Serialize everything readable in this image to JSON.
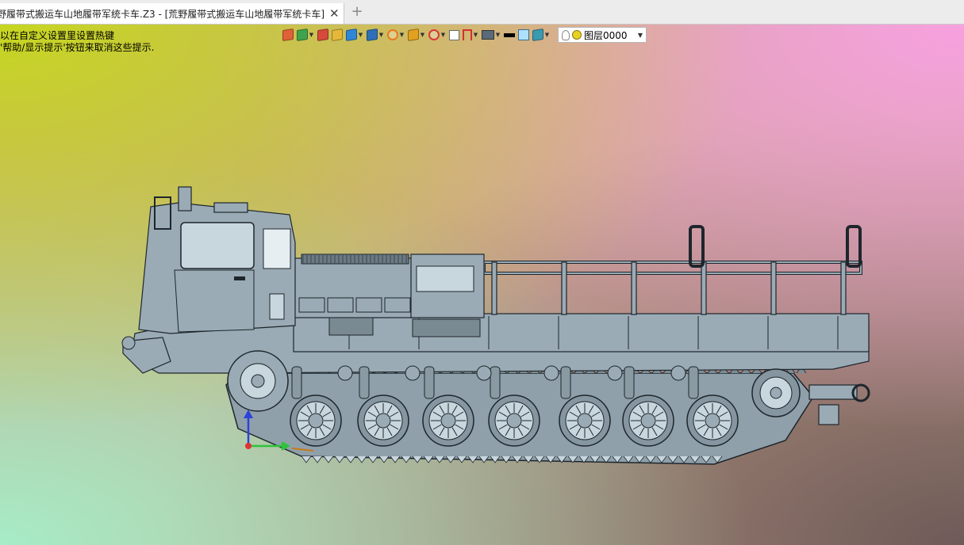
{
  "tab": {
    "title": "野履带式搬运车山地履带军统卡车.Z3 - [荒野履带式搬运车山地履带军统卡车]",
    "close": "✕",
    "add": "+"
  },
  "hints": [
    "以在自定义设置里设置热键",
    "'帮助/显示提示'按钮来取消这些提示."
  ],
  "toolbar": {
    "buttons": [
      {
        "name": "import-icon",
        "color": "#e0603a"
      },
      {
        "name": "paint-bucket-icon",
        "color": "#3fa34d",
        "dropdown": true
      },
      {
        "name": "pencil-icon",
        "color": "#d64a3a"
      },
      {
        "name": "box-yellow-icon",
        "color": "#e6b83a"
      },
      {
        "name": "cube-blue-icon",
        "color": "#2f86d6",
        "dropdown": true
      },
      {
        "name": "cubes-icon",
        "color": "#2f6fb8",
        "dropdown": true
      },
      {
        "name": "wheel-icon",
        "color": "#e87a1f",
        "dropdown": true
      },
      {
        "name": "frame-icon",
        "color": "#e0a020",
        "dropdown": true
      },
      {
        "name": "target-icon",
        "color": "#d63a3a",
        "dropdown": true
      },
      {
        "name": "section-icon",
        "color": "#6a6a6a"
      },
      {
        "name": "dimension-icon",
        "color": "#d23030",
        "dropdown": true
      },
      {
        "name": "monitor-icon",
        "color": "#5a6a7a",
        "dropdown": true
      },
      {
        "name": "line-black-icon",
        "color": "#000000"
      },
      {
        "name": "square-lightblue-icon",
        "color": "#aee0ff"
      },
      {
        "name": "layers-icon",
        "color": "#3a9ab0",
        "dropdown": true
      }
    ],
    "layer": {
      "label": "图层0000",
      "bulb_color": "#f4d53a",
      "dot_color": "#e7d21f"
    }
  },
  "colors": {
    "truck_fill": "#9aabb5",
    "truck_line": "#1e262c",
    "truck_light": "#c8d6de",
    "axis_x": "#2ec43a",
    "axis_y": "#2a44d8",
    "axis_origin": "#d33"
  }
}
